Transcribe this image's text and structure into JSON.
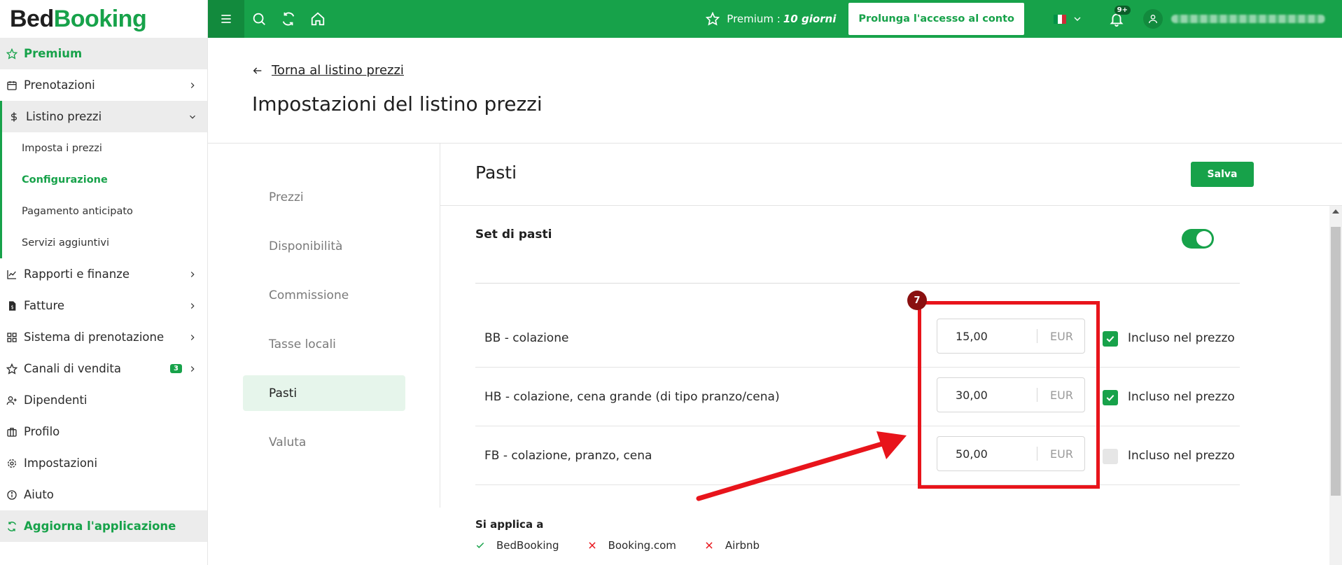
{
  "brand": {
    "part1": "Bed",
    "part2": "Booking"
  },
  "sidebar": {
    "items": [
      {
        "label": "Premium",
        "icon": "star-icon"
      },
      {
        "label": "Prenotazioni",
        "icon": "calendar-icon"
      },
      {
        "label": "Listino prezzi",
        "icon": "dollar-icon"
      },
      {
        "label": "Rapporti e finanze",
        "icon": "chart-icon"
      },
      {
        "label": "Fatture",
        "icon": "invoice-icon"
      },
      {
        "label": "Sistema di prenotazione",
        "icon": "grid-icon"
      },
      {
        "label": "Canali di vendita",
        "icon": "star-outline-icon",
        "badge": "3"
      },
      {
        "label": "Dipendenti",
        "icon": "user-plus-icon"
      },
      {
        "label": "Profilo",
        "icon": "briefcase-icon"
      },
      {
        "label": "Impostazioni",
        "icon": "gear-icon"
      },
      {
        "label": "Aiuto",
        "icon": "info-icon"
      },
      {
        "label": "Aggiorna l'applicazione",
        "icon": "refresh-icon"
      }
    ],
    "submenu": [
      "Imposta i prezzi",
      "Configurazione",
      "Pagamento anticipato",
      "Servizi aggiuntivi"
    ]
  },
  "topbar": {
    "premium_label": "Premium :",
    "premium_value": "10 giorni",
    "extend_button": "Prolunga l'accesso al conto",
    "notifications_badge": "9+",
    "language": "it"
  },
  "page": {
    "back_link": "Torna al listino prezzi",
    "title": "Impostazioni del listino prezzi"
  },
  "settings_menu": [
    "Prezzi",
    "Disponibilità",
    "Commissione",
    "Tasse locali",
    "Pasti",
    "Valuta"
  ],
  "content": {
    "title": "Pasti",
    "save_button": "Salva",
    "set_label": "Set di pasti",
    "set_enabled": true,
    "meals": [
      {
        "name": "BB - colazione",
        "price": "15,00",
        "currency": "EUR",
        "included": true,
        "included_label": "Incluso nel prezzo"
      },
      {
        "name": "HB - colazione, cena grande (di tipo pranzo/cena)",
        "price": "30,00",
        "currency": "EUR",
        "included": true,
        "included_label": "Incluso nel prezzo"
      },
      {
        "name": "FB - colazione, pranzo, cena",
        "price": "50,00",
        "currency": "EUR",
        "included": false,
        "included_label": "Incluso nel prezzo"
      }
    ],
    "applies_label": "Si applica a",
    "channels": [
      {
        "name": "BedBooking",
        "enabled": true
      },
      {
        "name": "Booking.com",
        "enabled": false
      },
      {
        "name": "Airbnb",
        "enabled": false
      }
    ]
  },
  "annotation": {
    "step": "7"
  },
  "colors": {
    "primary": "#17a24a",
    "highlight": "#e8141b",
    "badge": "#8a1010"
  }
}
